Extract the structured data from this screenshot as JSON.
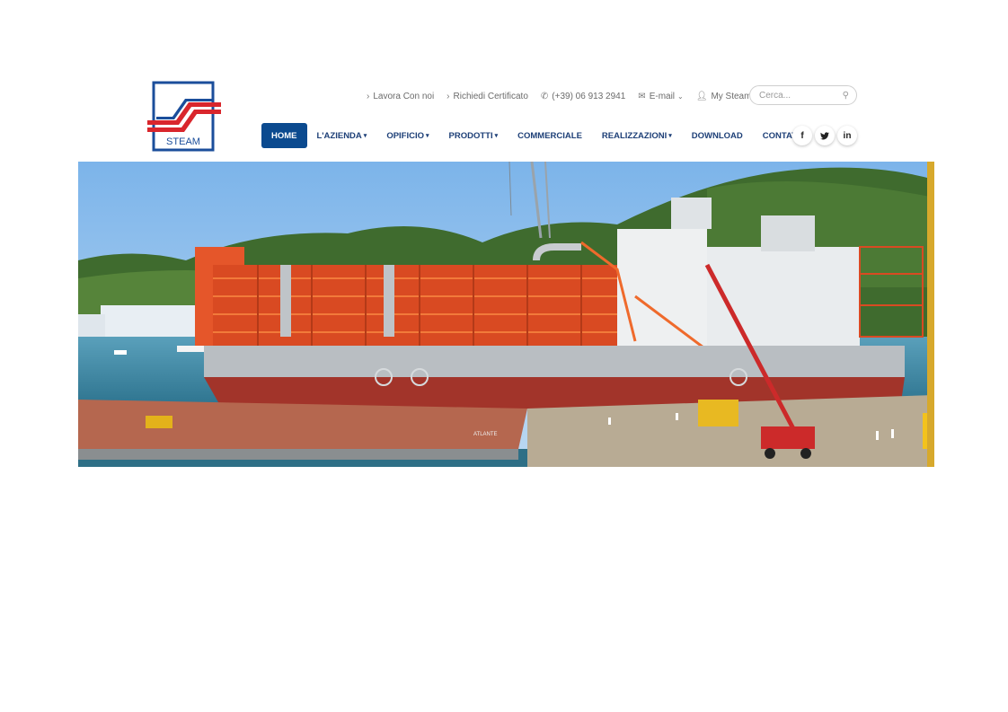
{
  "logo": {
    "text": "STEAM"
  },
  "topbar": {
    "lavora": "Lavora Con noi",
    "certificato": "Richiedi Certificato",
    "phone": "(+39) 06 913 2941",
    "email": "E-mail",
    "mysteam": "My Steam"
  },
  "search": {
    "placeholder": "Cerca..."
  },
  "nav": {
    "home": "HOME",
    "azienda": "L'AZIENDA",
    "opificio": "OPIFICIO",
    "prodotti": "PRODOTTI",
    "commerciale": "COMMERCIALE",
    "realizzazioni": "REALIZZAZIONI",
    "download": "DOWNLOAD",
    "contatti": "CONTATTI"
  },
  "social": {
    "facebook": "f",
    "twitter": "t",
    "linkedin": "in"
  },
  "hero": {
    "barge_name": "ATLANTE"
  }
}
